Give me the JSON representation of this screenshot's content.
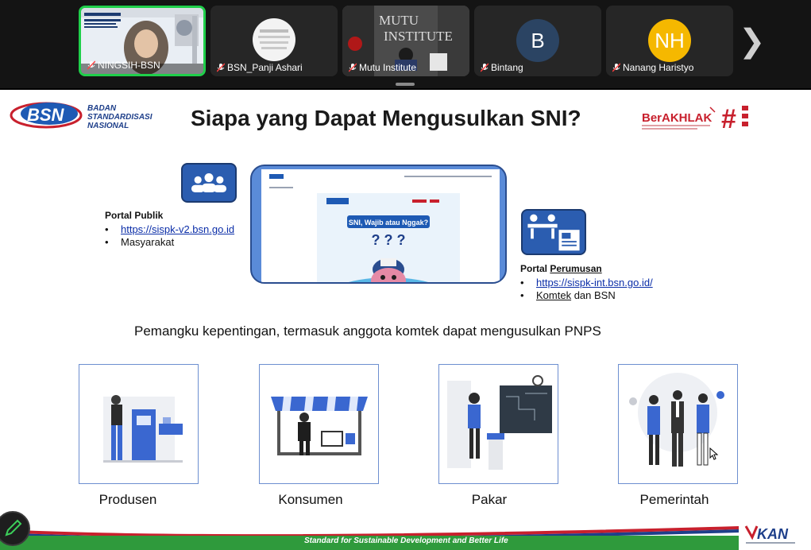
{
  "participants": [
    {
      "name": "NINGSIH-BSN",
      "active": true
    },
    {
      "name": "BSN_Panji Ashari",
      "active": false
    },
    {
      "name": "Mutu Institute",
      "active": false
    },
    {
      "name": "Bintang",
      "initials": "B",
      "color": "#2b4463"
    },
    {
      "name": "Nanang Haristyo",
      "initials": "NH",
      "color": "#f5b800"
    }
  ],
  "strip": {
    "next_glyph": "❯"
  },
  "slide": {
    "logo": {
      "line1": "BADAN",
      "line2": "STANDARDISASI",
      "line3": "NASIONAL",
      "mark": "BSN"
    },
    "title": "Siapa yang Dapat Mengusulkan SNI?",
    "berakhlak": "BerAKHLAK",
    "portal_publik": {
      "title": "Portal Publik",
      "items": [
        "https://sispk-v2.bsn.go.id",
        "Masyarakat"
      ]
    },
    "screen": {
      "banner": "SNI, Wajib atau Nggak?",
      "marks": "? ? ?"
    },
    "portal_perumusan": {
      "title_prefix": "Portal ",
      "title_underlined": "Perumusan",
      "link": "https://sispk-int.bsn.go.id/",
      "item2_underlined": "Komtek",
      "item2_rest": " dan BSN"
    },
    "caption": "Pemangku kepentingan, termasuk anggota komtek dapat mengusulkan PNPS",
    "cards": [
      {
        "label": "Produsen"
      },
      {
        "label": "Konsumen"
      },
      {
        "label": "Pakar"
      },
      {
        "label": "Pemerintah"
      }
    ],
    "footer": "Standard for Sustainable Development and Better Life",
    "kan": "KAN"
  },
  "colors": {
    "accent": "#1fcf4a",
    "bsn_blue": "#2b5db0",
    "footer_green": "#2f9a3c",
    "footer_red": "#c8202d"
  }
}
